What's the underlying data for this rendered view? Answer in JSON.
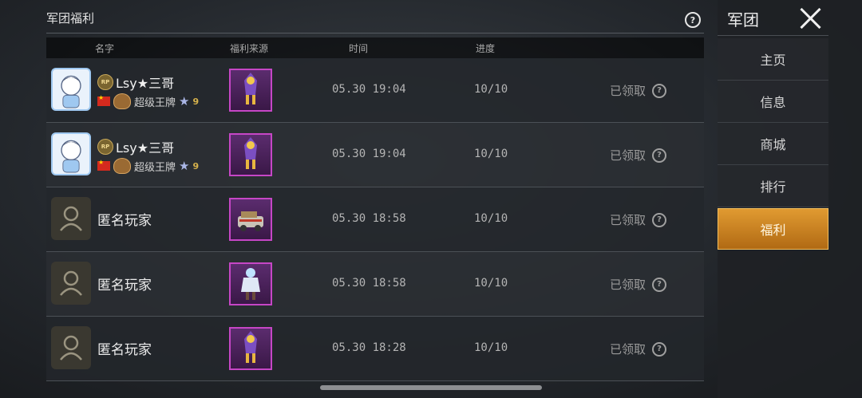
{
  "panel": {
    "title": "军团福利"
  },
  "columns": {
    "name": "名字",
    "source": "福利来源",
    "time": "时间",
    "progress": "进度"
  },
  "rows": [
    {
      "type": "user",
      "badge": "RP",
      "name": "Lsy★三哥",
      "rank": "超级王牌",
      "stars": "9",
      "time": "05.30 19:04",
      "progress": "10/10",
      "status": "已领取"
    },
    {
      "type": "user",
      "badge": "RP",
      "name": "Lsy★三哥",
      "rank": "超级王牌",
      "stars": "9",
      "time": "05.30 19:04",
      "progress": "10/10",
      "status": "已领取"
    },
    {
      "type": "anon",
      "name": "匿名玩家",
      "time": "05.30 18:58",
      "progress": "10/10",
      "status": "已领取"
    },
    {
      "type": "anon",
      "name": "匿名玩家",
      "time": "05.30 18:58",
      "progress": "10/10",
      "status": "已领取"
    },
    {
      "type": "anon",
      "name": "匿名玩家",
      "time": "05.30 18:28",
      "progress": "10/10",
      "status": "已领取"
    }
  ],
  "sidebar": {
    "title": "军团",
    "items": [
      {
        "label": "主页"
      },
      {
        "label": "信息"
      },
      {
        "label": "商城"
      },
      {
        "label": "排行"
      },
      {
        "label": "福利"
      }
    ],
    "active": "福利"
  },
  "colors": {
    "accent": "#e09a31",
    "item_border": "#c646c6"
  }
}
